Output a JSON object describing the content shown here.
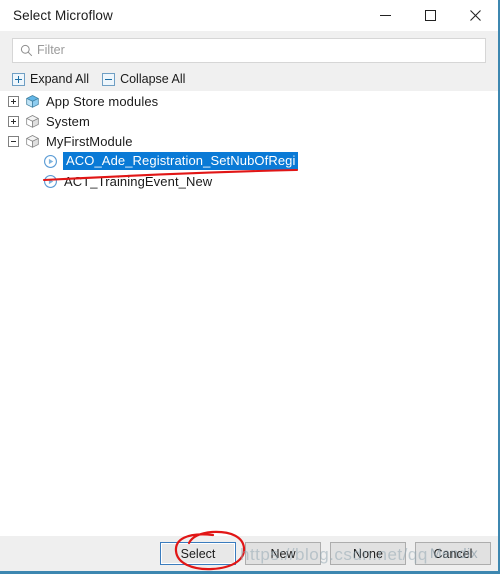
{
  "window": {
    "title": "Select Microflow",
    "controls": [
      {
        "name": "minimize",
        "glyph": "minimize-icon"
      },
      {
        "name": "maximize",
        "glyph": "maximize-icon"
      },
      {
        "name": "close",
        "glyph": "close-icon"
      }
    ]
  },
  "toolbar": {
    "filter": {
      "value": "",
      "placeholder": "Filter",
      "icon": "search-icon"
    },
    "expand_all_label": "Expand All",
    "collapse_all_label": "Collapse All"
  },
  "tree": {
    "nodes": [
      {
        "label": "App Store modules",
        "icon": "module-icon",
        "icon_color": "#4aa8de",
        "expanded": false,
        "level": 0,
        "selected": false
      },
      {
        "label": "System",
        "icon": "module-icon",
        "icon_color": "#d8d8d8",
        "expanded": false,
        "level": 0,
        "selected": false
      },
      {
        "label": "MyFirstModule",
        "icon": "module-icon",
        "icon_color": "#d8d8d8",
        "expanded": true,
        "level": 0,
        "selected": false
      },
      {
        "label": "ACO_Ade_Registration_SetNubOfRegi",
        "icon": "microflow-icon",
        "icon_color": "#5a9bd5",
        "level": 1,
        "selected": true
      },
      {
        "label": "ACT_TrainingEvent_New",
        "icon": "microflow-icon",
        "icon_color": "#5a9bd5",
        "level": 1,
        "selected": false
      }
    ]
  },
  "footer": {
    "buttons": [
      {
        "label": "Select",
        "primary": true
      },
      {
        "label": "New",
        "primary": false
      },
      {
        "label": "None",
        "primary": false
      },
      {
        "label": "Cancel",
        "primary": false
      }
    ]
  },
  "annotations": {
    "selection_color": "#0a7ad6",
    "ink_color": "#e11616",
    "strikethrough_note": "red hand-drawn line across ACT_TrainingEvent_New row",
    "circle_note": "red hand-drawn ellipse around Select button"
  },
  "watermark": {
    "bottom_text": "https://blog.csdn.net/qq",
    "button_text": "Mendix"
  }
}
